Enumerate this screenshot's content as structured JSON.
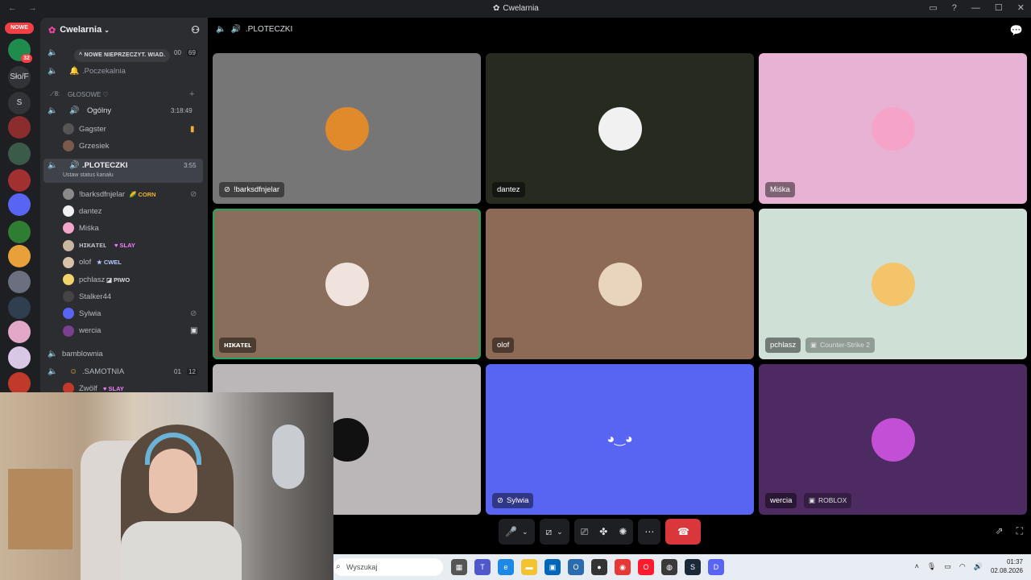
{
  "window": {
    "title": "Cwelarnia"
  },
  "rail": {
    "new_label": "NOWE",
    "servers": [
      {
        "label": "",
        "badge": "32",
        "color": "#1f8b4c"
      },
      {
        "label": "Sło/F",
        "badge": "",
        "color": "#313338"
      },
      {
        "label": "S",
        "badge": "",
        "color": "#313338"
      },
      {
        "label": "",
        "badge": "",
        "color": "#8b2d2d"
      },
      {
        "label": "",
        "badge": "",
        "color": "#3b5b4a"
      },
      {
        "label": "",
        "badge": "",
        "color": "#a33030"
      },
      {
        "label": "",
        "badge": "",
        "color": "#5865f2"
      },
      {
        "label": "",
        "badge": "",
        "color": "#2e7d32"
      },
      {
        "label": "",
        "badge": "",
        "color": "#e8a13a"
      },
      {
        "label": "",
        "badge": "",
        "color": "#6b6f80"
      },
      {
        "label": "",
        "badge": "",
        "color": "#2f3f4f"
      },
      {
        "label": "",
        "badge": "",
        "color": "#e3a8c8"
      },
      {
        "label": "",
        "badge": "",
        "color": "#d9c7e6"
      },
      {
        "label": "",
        "badge": "",
        "color": "#c0392b"
      }
    ]
  },
  "sidebar": {
    "guild_name": "Cwelarnia",
    "new_unread_pill": "NOWE NIEPRZECZYT. WIAD.",
    "top_channel_meta": {
      "left": "00",
      "right": "69"
    },
    "channels": {
      "poczekalnia": ".Poczekalnia",
      "category": "GŁOSOWE ♡",
      "ogolny": {
        "name": "Ogólny",
        "time": "3:18:49"
      },
      "ogolny_users": [
        "Gagster",
        "Grzesiek"
      ],
      "ploteczki": {
        "name": ".PLOTECZKI",
        "time": "3:55",
        "status": "Ustaw status kanału"
      },
      "ploteczki_users": [
        {
          "name": "!barksdfnjelar",
          "tag": "CORN",
          "color": "#8a8a8a"
        },
        {
          "name": "dantez",
          "tag": "",
          "color": "#f0f0f0"
        },
        {
          "name": "Miśka",
          "tag": "",
          "color": "#f3a6c9"
        },
        {
          "name": "ʜɪᴋᴀᴛᴇʟ",
          "tag": "SLAY",
          "color": "#c9b6a0"
        },
        {
          "name": "olof",
          "tag": "CWEL",
          "color": "#d8c2a8"
        },
        {
          "name": "pchlasz",
          "tag": "PIWO",
          "color": "#f3d36b"
        },
        {
          "name": "Stalker44",
          "tag": "",
          "color": "#444"
        },
        {
          "name": "Sylwia",
          "tag": "",
          "color": "#5865f2"
        },
        {
          "name": "wercia",
          "tag": "",
          "color": "#7a3f8f"
        }
      ],
      "bamblownia": "bamblownia",
      "samotnia": {
        "name": ".SAMOTNIA",
        "left": "01",
        "right": "12"
      },
      "samotnia_user": {
        "name": "Zwölf",
        "tag": "SLAY"
      }
    }
  },
  "call": {
    "channel": ".PLOTECZKI",
    "tiles": [
      {
        "name": "!barksdfnjelar",
        "bg": "#777676",
        "avatar": "#e08a2b",
        "muted": true,
        "activity": "",
        "speaking": false
      },
      {
        "name": "dantez",
        "bg": "#262a1f",
        "avatar": "#f1f1f1",
        "muted": false,
        "activity": "",
        "speaking": false
      },
      {
        "name": "Miśka",
        "bg": "#e8b2d4",
        "avatar": "#f6a3c8",
        "muted": false,
        "activity": "",
        "speaking": false
      },
      {
        "name": "ʜɪᴋᴀᴛᴇʟ",
        "bg": "#896f5b",
        "avatar": "#f0e2dc",
        "muted": false,
        "activity": "",
        "speaking": true
      },
      {
        "name": "olof",
        "bg": "#8d6a56",
        "avatar": "#e9d4bd",
        "muted": false,
        "activity": "",
        "speaking": false
      },
      {
        "name": "pchlasz",
        "bg": "#cfe1d6",
        "avatar": "#f4c46b",
        "muted": false,
        "activity": "Counter-Strike 2",
        "speaking": false
      },
      {
        "name": "",
        "bg": "#bbb6b8",
        "avatar": "#111111",
        "muted": false,
        "activity": "",
        "speaking": false
      },
      {
        "name": "Sylwia",
        "bg": "#5865f2",
        "avatar": "#5865f2",
        "muted": true,
        "activity": "",
        "speaking": false
      },
      {
        "name": "wercia",
        "bg": "#4e2a62",
        "avatar": "#c24fd6",
        "muted": false,
        "activity": "ROBLOX",
        "speaking": false
      }
    ]
  },
  "taskbar": {
    "search_placeholder": "Wyszukaj",
    "time": "01:37",
    "date": "02.08.2026"
  }
}
